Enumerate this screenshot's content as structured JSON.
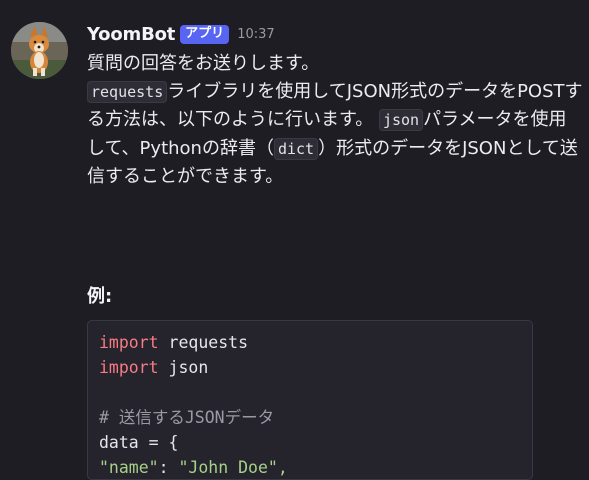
{
  "message": {
    "author": "YoomBot",
    "badge": "アプリ",
    "time": "10:37",
    "paragraph1": "質問の回答をお送りします。",
    "p2_code1": "requests",
    "p2_text1": "ライブラリを使用してJSON形式のデータをPOSTする方法は、以下のように行います。",
    "p2_code2": "json",
    "p2_text2": "パラメータを使用して、Pythonの辞書（",
    "p2_code3": "dict",
    "p2_text3": "）形式のデータをJSONとして送信することができます。",
    "example_heading": "例:"
  },
  "code": {
    "line1_kw": "import",
    "line1_rest": " requests",
    "line2_kw": "import",
    "line2_rest": " json",
    "line4_comment": "# 送信するJSONデータ",
    "line5": "data = {",
    "line6_key": "\"name\"",
    "line6_sep": ": ",
    "line6_val": "\"John Doe\","
  },
  "colors": {
    "background": "#1f1d24",
    "badge": "#5865f2",
    "keyword": "#f67b82",
    "comment": "#9b99a3"
  }
}
